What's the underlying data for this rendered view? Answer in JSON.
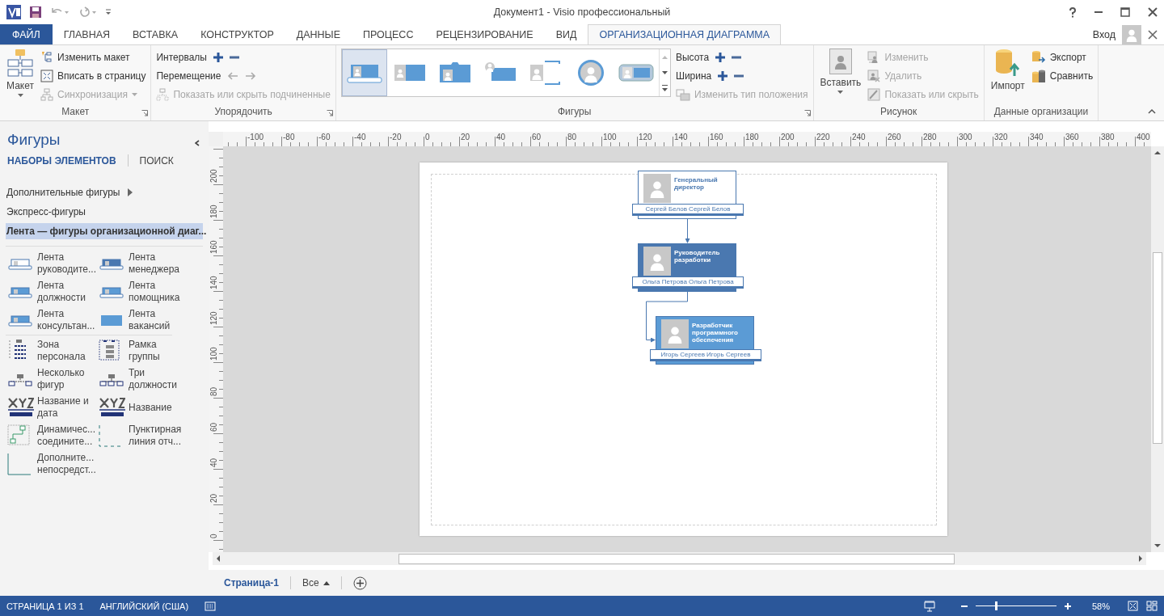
{
  "window": {
    "title": "Документ1 - Visio профессиональный"
  },
  "account": {
    "label": "Вход"
  },
  "tabs": [
    {
      "label": "ФАЙЛ",
      "kind": "file",
      "selected": false
    },
    {
      "label": "ГЛАВНАЯ",
      "kind": "tab",
      "selected": false
    },
    {
      "label": "ВСТАВКА",
      "kind": "tab",
      "selected": false
    },
    {
      "label": "КОНСТРУКТОР",
      "kind": "tab",
      "selected": false
    },
    {
      "label": "ДАННЫЕ",
      "kind": "tab",
      "selected": false
    },
    {
      "label": "ПРОЦЕСС",
      "kind": "tab",
      "selected": false
    },
    {
      "label": "РЕЦЕНЗИРОВАНИЕ",
      "kind": "tab",
      "selected": false
    },
    {
      "label": "ВИД",
      "kind": "tab",
      "selected": false
    },
    {
      "label": "ОРГАНИЗАЦИОННАЯ ДИАГРАММА",
      "kind": "tab",
      "selected": true
    }
  ],
  "ribbon": {
    "groups": [
      {
        "kind": "layout",
        "label": "Макет",
        "big": {
          "label": "Макет"
        },
        "items": [
          {
            "kind": "button",
            "label": "Изменить макет",
            "disabled": false
          },
          {
            "kind": "button",
            "label": "Вписать в страницу",
            "disabled": false
          },
          {
            "kind": "button",
            "label": "Синхронизация",
            "disabled": true
          }
        ]
      },
      {
        "kind": "arrange",
        "label": "Упорядочить",
        "items": [
          {
            "kind": "stepper",
            "label": "Интервалы",
            "disabled": false
          },
          {
            "kind": "arrows",
            "label": "Перемещение",
            "disabled": false
          },
          {
            "kind": "button",
            "label": "Показать или скрыть подчиненные",
            "disabled": true
          }
        ]
      },
      {
        "kind": "shapes",
        "label": "Фигуры",
        "gallery": [
          {
            "kind": "belt",
            "selected": true
          },
          {
            "kind": "block",
            "selected": false
          },
          {
            "kind": "tab",
            "selected": false
          },
          {
            "kind": "pin",
            "selected": false
          },
          {
            "kind": "bracket",
            "selected": false
          },
          {
            "kind": "circle",
            "selected": false
          },
          {
            "kind": "card",
            "selected": false
          }
        ],
        "items": [
          {
            "kind": "stepper",
            "label": "Высота",
            "disabled": false
          },
          {
            "kind": "stepper",
            "label": "Ширина",
            "disabled": false
          },
          {
            "kind": "button",
            "label": "Изменить тип положения",
            "disabled": true
          }
        ]
      },
      {
        "kind": "picture",
        "label": "Рисунок",
        "big": {
          "label": "Вставить"
        },
        "items": [
          {
            "kind": "button",
            "label": "Изменить",
            "disabled": true
          },
          {
            "kind": "button",
            "label": "Удалить",
            "disabled": true
          },
          {
            "kind": "button",
            "label": "Показать или скрыть",
            "disabled": true
          }
        ]
      },
      {
        "kind": "org_data",
        "label": "Данные организации",
        "big": {
          "label": "Импорт"
        },
        "items": [
          {
            "kind": "button",
            "label": "Экспорт",
            "disabled": false
          },
          {
            "kind": "button",
            "label": "Сравнить",
            "disabled": false
          }
        ]
      }
    ]
  },
  "shapes_panel": {
    "title": "Фигуры",
    "nav": [
      {
        "label": "НАБОРЫ ЭЛЕМЕНТОВ",
        "selected": true
      },
      {
        "label": "ПОИСК",
        "selected": false
      }
    ],
    "stencils": [
      {
        "label": "Дополнительные фигуры",
        "kind": "submenu",
        "selected": false
      },
      {
        "label": "Экспресс-фигуры",
        "kind": "item",
        "selected": false
      },
      {
        "label": "Лента — фигуры организационной диаг...",
        "kind": "item",
        "selected": true
      }
    ],
    "groups": [
      [
        {
          "kind": "executive",
          "label": "Лента руководите..."
        },
        {
          "kind": "manager",
          "label": "Лента менеджера"
        },
        {
          "kind": "position",
          "label": "Лента должности"
        },
        {
          "kind": "assistant",
          "label": "Лента помощника"
        },
        {
          "kind": "consultant",
          "label": "Лента консультан..."
        },
        {
          "kind": "vacancy",
          "label": "Лента вакансий"
        }
      ],
      [
        {
          "kind": "staff",
          "label": "Зона персонала"
        },
        {
          "kind": "frame",
          "label": "Рамка группы"
        },
        {
          "kind": "multiple",
          "label": "Несколько фигур"
        },
        {
          "kind": "three",
          "label": "Три должности"
        },
        {
          "kind": "title_date",
          "label": "Название и дата"
        },
        {
          "kind": "title",
          "label": "Название"
        },
        {
          "kind": "connector",
          "label": "Динамичес... соедините..."
        },
        {
          "kind": "dotted",
          "label": "Пунктирная линия отч..."
        },
        {
          "kind": "solid",
          "label": "Дополните... непосредст..."
        }
      ]
    ]
  },
  "rulers": {
    "x_labels": [
      "-100",
      "-80",
      "-60",
      "-40",
      "-20",
      "0",
      "20",
      "40",
      "60",
      "80",
      "100",
      "120",
      "140",
      "160",
      "180",
      "200",
      "220",
      "240",
      "260",
      "280",
      "300",
      "320",
      "340",
      "360",
      "380",
      "400"
    ],
    "y_labels": [
      "200",
      "180",
      "160",
      "140",
      "120",
      "100",
      "80",
      "60",
      "40",
      "20",
      "0"
    ]
  },
  "org_chart": {
    "title": "Генеральный директор",
    "name": "Сергей Белов Сергей Белов",
    "color": "#ffffff",
    "children": [
      {
        "title": "Руководитель разработки",
        "name": "Ольга Петрова Ольга Петрова",
        "color": "#4a78b0",
        "children": [
          {
            "title": "Разработчик программного обеспечения",
            "name": "Игорь Сергеев Игорь Сергеев",
            "color": "#5b9bd5"
          }
        ]
      }
    ]
  },
  "page_tabs": {
    "pages": [
      {
        "label": "Страница-1",
        "selected": true
      }
    ],
    "all": "Все"
  },
  "status_bar": {
    "page": "СТРАНИЦА 1 ИЗ 1",
    "language": "АНГЛИЙСКИЙ (США)",
    "zoom": "58%",
    "zoom_slider": {
      "level": 0.25
    }
  }
}
